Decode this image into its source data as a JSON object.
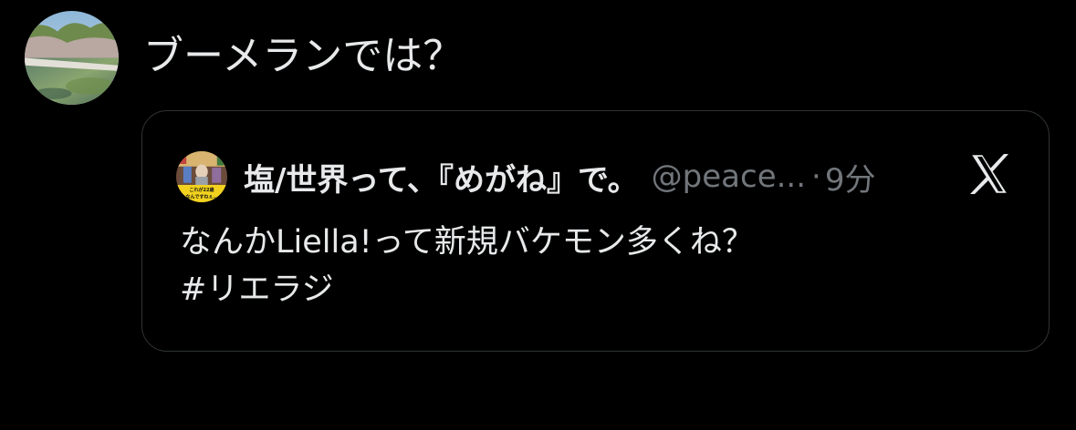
{
  "reply": {
    "avatar_icon": "lake-photo-avatar",
    "text": "ブーメランでは？"
  },
  "quoted_post": {
    "avatar_icon": "figure-photo-avatar",
    "avatar_caption": "これが22歳 なんですねぇ…",
    "display_name": "塩/世界って、『めがね』で。",
    "handle": "@peace...",
    "separator": "·",
    "timestamp": "9分",
    "body_line1": "なんかLiella!って新規バケモン多くね？",
    "body_line2": "#リエラジ",
    "close_icon": "x-logo-icon"
  },
  "colors": {
    "background": "#000000",
    "text_primary": "#e7e9ea",
    "text_secondary": "#71767b",
    "card_border": "#2f3336"
  }
}
